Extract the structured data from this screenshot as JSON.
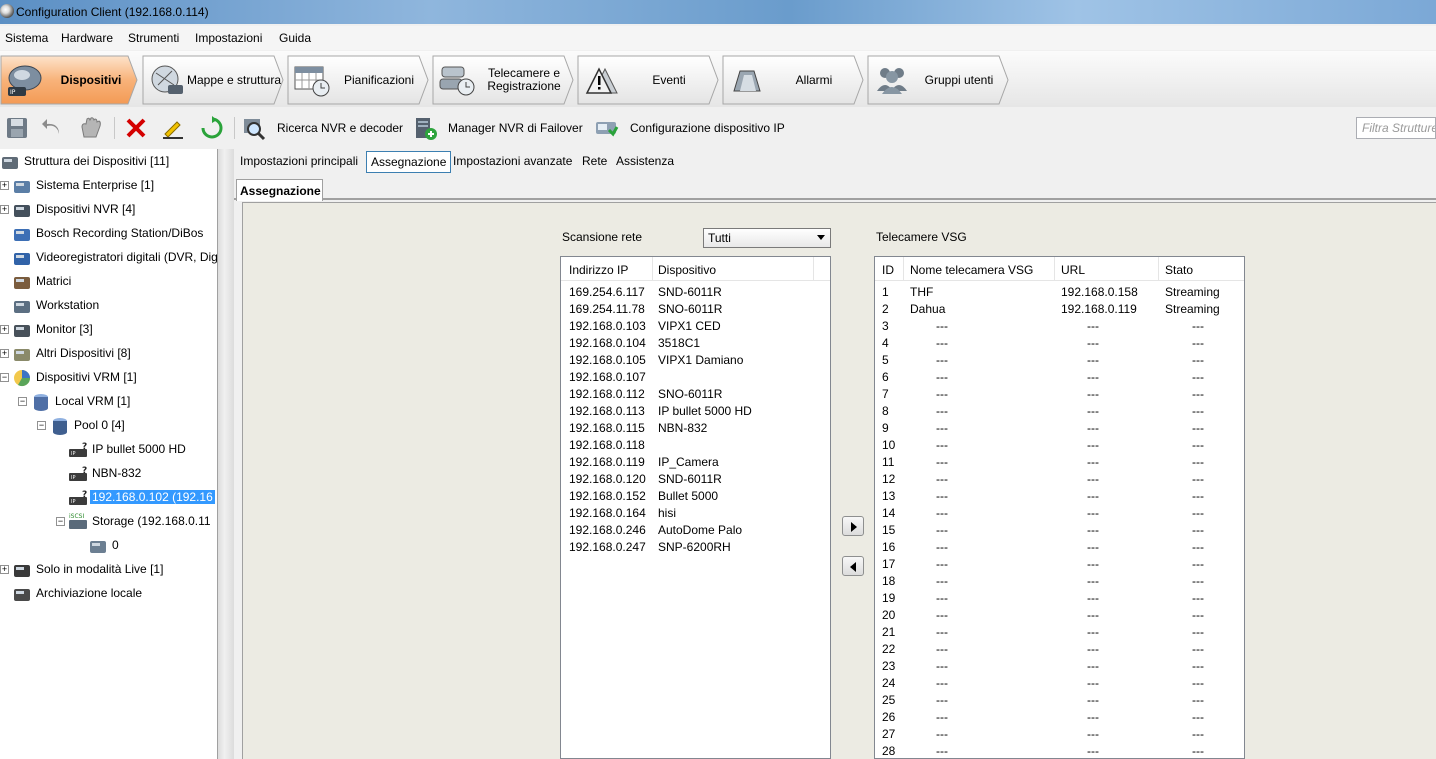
{
  "window": {
    "title": "Configuration Client (192.168.0.114)"
  },
  "menu": [
    "Sistema",
    "Hardware",
    "Strumenti",
    "Impostazioni",
    "Guida"
  ],
  "nav_tabs": [
    {
      "label": "Dispositivi",
      "icon": "devices-icon",
      "active": true
    },
    {
      "label": "Mappe e struttura",
      "icon": "maps-icon",
      "active": false
    },
    {
      "label": "Pianificazioni",
      "icon": "calendar-icon",
      "active": false
    },
    {
      "label": "Telecamere e Registrazione",
      "icon": "cameras-icon",
      "active": false
    },
    {
      "label": "Eventi",
      "icon": "warning-icon",
      "active": false
    },
    {
      "label": "Allarmi",
      "icon": "alarm-icon",
      "active": false
    },
    {
      "label": "Gruppi utenti",
      "icon": "users-icon",
      "active": false
    }
  ],
  "toolbar": {
    "search_nvr": "Ricerca NVR e decoder",
    "failover": "Manager NVR di Failover",
    "ip_config": "Configurazione dispositivo IP",
    "filter_placeholder": "Filtra Strutture"
  },
  "tree": [
    {
      "label": "Struttura dei Dispositivi [11]",
      "icon": "device-tree-icon"
    },
    {
      "label": "Sistema Enterprise [1]",
      "icon": "enterprise-icon"
    },
    {
      "label": "Dispositivi NVR [4]",
      "icon": "nvr-icon"
    },
    {
      "label": "Bosch Recording Station/DiBos",
      "icon": "recording-station-icon"
    },
    {
      "label": "Videoregistratori digitali (DVR, Digi",
      "icon": "dvr-icon"
    },
    {
      "label": "Matrici",
      "icon": "matrix-icon"
    },
    {
      "label": "Workstation",
      "icon": "workstation-icon"
    },
    {
      "label": "Monitor [3]",
      "icon": "monitor-icon"
    },
    {
      "label": "Altri Dispositivi [8]",
      "icon": "other-devices-icon"
    },
    {
      "label": "Dispositivi VRM [1]",
      "icon": "vrm-icon"
    },
    {
      "label": "Local VRM [1]",
      "icon": "database-icon"
    },
    {
      "label": "Pool 0 [4]",
      "icon": "pool-icon"
    },
    {
      "label": "IP bullet 5000 HD",
      "icon": "encoder-icon"
    },
    {
      "label": "NBN-832",
      "icon": "encoder-icon"
    },
    {
      "label": "192.168.0.102 (192.16",
      "icon": "encoder-icon"
    },
    {
      "label": "Storage (192.168.0.11",
      "icon": "iscsi-icon",
      "badge": "iSCSI"
    },
    {
      "label": "0",
      "icon": "lun-icon"
    },
    {
      "label": "Solo in modalità Live [1]",
      "icon": "live-camera-icon"
    },
    {
      "label": "Archiviazione locale",
      "icon": "local-storage-icon"
    }
  ],
  "subtabs": [
    "Impostazioni principali",
    "Assegnazione",
    "Impostazioni avanzate",
    "Rete",
    "Assistenza"
  ],
  "inner_tab": "Assegnazione",
  "scan": {
    "label": "Scansione rete",
    "selected": "Tutti"
  },
  "left_list": {
    "headers": [
      "Indirizzo IP",
      "Dispositivo"
    ],
    "rows": [
      [
        "169.254.6.117",
        "SND-6011R"
      ],
      [
        "169.254.11.78",
        "SNO-6011R"
      ],
      [
        "192.168.0.103",
        "VIPX1 CED"
      ],
      [
        "192.168.0.104",
        "3518C1"
      ],
      [
        "192.168.0.105",
        "VIPX1 Damiano"
      ],
      [
        "192.168.0.107",
        ""
      ],
      [
        "192.168.0.112",
        "SNO-6011R"
      ],
      [
        "192.168.0.113",
        "IP bullet 5000 HD"
      ],
      [
        "192.168.0.115",
        "NBN-832"
      ],
      [
        "192.168.0.118",
        ""
      ],
      [
        "192.168.0.119",
        "IP_Camera"
      ],
      [
        "192.168.0.120",
        "SND-6011R"
      ],
      [
        "192.168.0.152",
        "Bullet 5000"
      ],
      [
        "192.168.0.164",
        "hisi"
      ],
      [
        "192.168.0.246",
        "AutoDome Palo"
      ],
      [
        "192.168.0.247",
        "SNP-6200RH"
      ]
    ]
  },
  "vsg": {
    "label": "Telecamere VSG",
    "headers": [
      "ID",
      "Nome telecamera VSG",
      "URL",
      "Stato"
    ],
    "rows": [
      [
        "1",
        "THF",
        "192.168.0.158",
        "Streaming"
      ],
      [
        "2",
        "Dahua",
        "192.168.0.119",
        "Streaming"
      ],
      [
        "3",
        "---",
        "---",
        "---"
      ],
      [
        "4",
        "---",
        "---",
        "---"
      ],
      [
        "5",
        "---",
        "---",
        "---"
      ],
      [
        "6",
        "---",
        "---",
        "---"
      ],
      [
        "7",
        "---",
        "---",
        "---"
      ],
      [
        "8",
        "---",
        "---",
        "---"
      ],
      [
        "9",
        "---",
        "---",
        "---"
      ],
      [
        "10",
        "---",
        "---",
        "---"
      ],
      [
        "11",
        "---",
        "---",
        "---"
      ],
      [
        "12",
        "---",
        "---",
        "---"
      ],
      [
        "13",
        "---",
        "---",
        "---"
      ],
      [
        "14",
        "---",
        "---",
        "---"
      ],
      [
        "15",
        "---",
        "---",
        "---"
      ],
      [
        "16",
        "---",
        "---",
        "---"
      ],
      [
        "17",
        "---",
        "---",
        "---"
      ],
      [
        "18",
        "---",
        "---",
        "---"
      ],
      [
        "19",
        "---",
        "---",
        "---"
      ],
      [
        "20",
        "---",
        "---",
        "---"
      ],
      [
        "21",
        "---",
        "---",
        "---"
      ],
      [
        "22",
        "---",
        "---",
        "---"
      ],
      [
        "23",
        "---",
        "---",
        "---"
      ],
      [
        "24",
        "---",
        "---",
        "---"
      ],
      [
        "25",
        "---",
        "---",
        "---"
      ],
      [
        "26",
        "---",
        "---",
        "---"
      ],
      [
        "27",
        "---",
        "---",
        "---"
      ],
      [
        "28",
        "---",
        "---",
        "---"
      ]
    ]
  },
  "colors": {
    "active_tab": "#f8b37a",
    "selection": "#3399ff",
    "panel_bg": "#ecebe3"
  }
}
